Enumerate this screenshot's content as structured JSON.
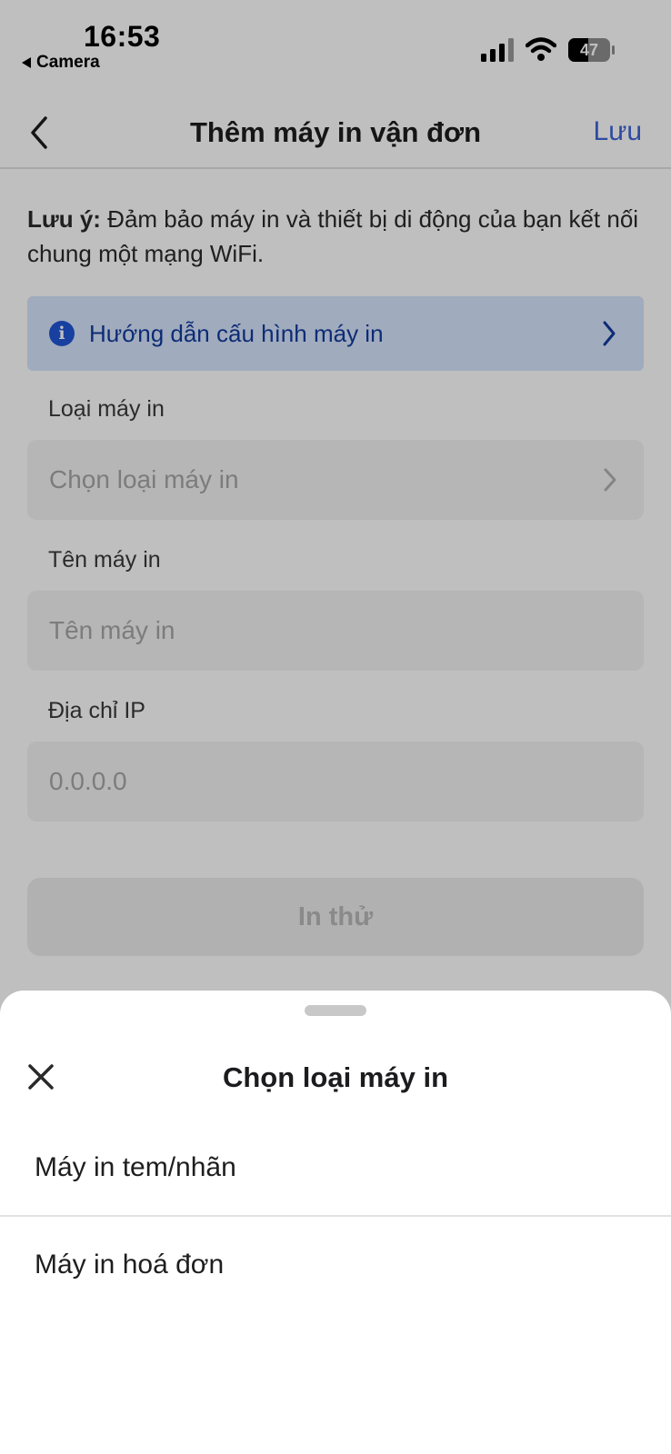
{
  "status_bar": {
    "time": "16:53",
    "back_app": "Camera",
    "battery": "47",
    "icons": [
      "signal-icon",
      "wifi-icon",
      "battery-icon"
    ]
  },
  "nav": {
    "title": "Thêm máy in vận đơn",
    "save_label": "Lưu",
    "back_icon": "chevron-left-icon"
  },
  "note": {
    "prefix": "Lưu ý:",
    "text": "Đảm bảo máy in và thiết bị di động của bạn kết nối chung một mạng WiFi."
  },
  "guide": {
    "label": "Hướng dẫn cấu hình máy in",
    "icon": "info-icon"
  },
  "form": {
    "printer_type": {
      "label": "Loại máy in",
      "placeholder": "Chọn loại máy in"
    },
    "printer_name": {
      "label": "Tên máy in",
      "placeholder": "Tên máy in"
    },
    "ip_address": {
      "label": "Địa chỉ IP",
      "placeholder": "0.0.0.0"
    },
    "test_print_label": "In thử"
  },
  "sheet": {
    "title": "Chọn loại máy in",
    "options": [
      "Máy in tem/nhãn",
      "Máy in hoá đơn"
    ]
  },
  "colors": {
    "accent": "#3f63d6",
    "guide_bg": "#d6e5fc",
    "guide_text": "#123b9e"
  }
}
